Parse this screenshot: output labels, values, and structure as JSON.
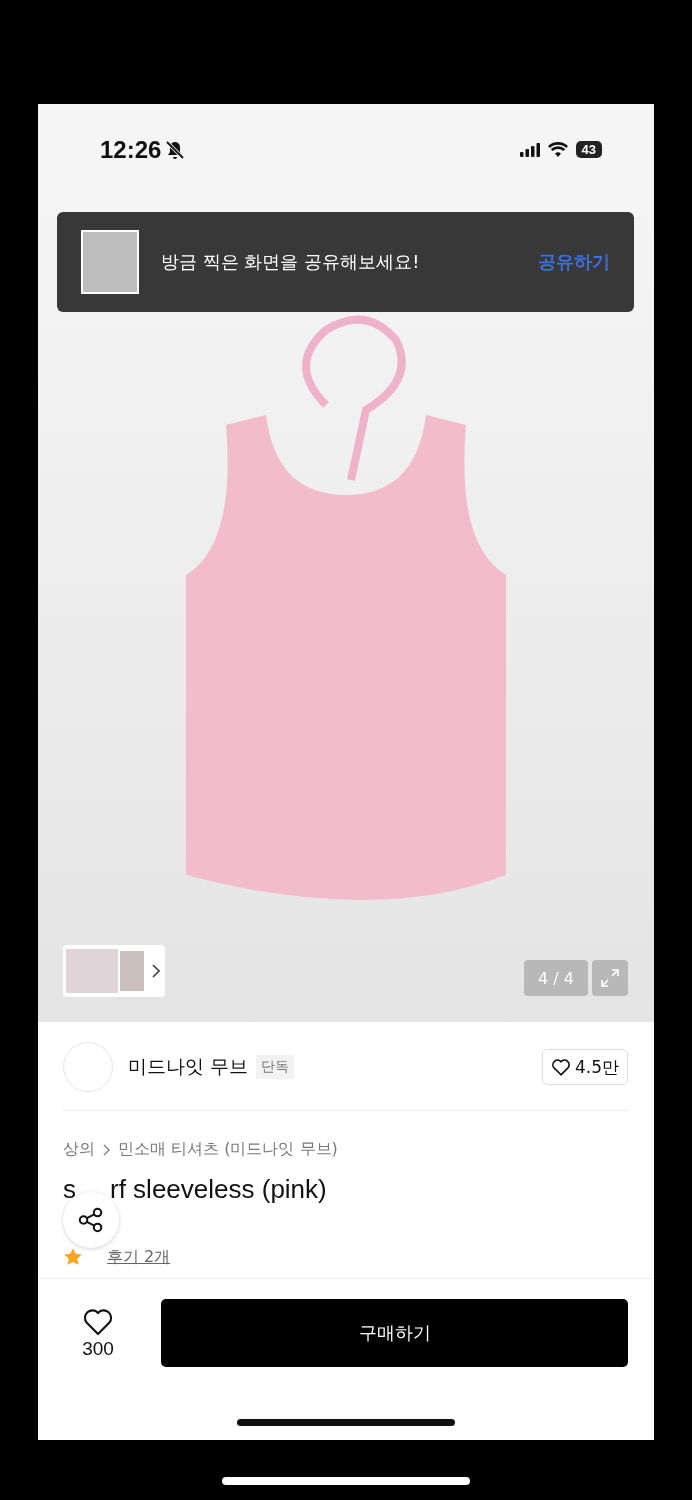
{
  "status_bar": {
    "time": "12:26",
    "silent": true,
    "battery": "43"
  },
  "share_banner": {
    "message": "방금 찍은 화면을 공유해보세요!",
    "action": "공유하기"
  },
  "gallery": {
    "counter": "4 / 4"
  },
  "store": {
    "name": "미드나잇 무브",
    "badge": "단독",
    "likes": "4.5만"
  },
  "breadcrumb": [
    "상의",
    "민소매 티셔츠 (미드나잇 무브)"
  ],
  "title_parts": [
    "s",
    "rf sleeveless (pink)"
  ],
  "reviews_link": "후기 2개",
  "bottom_bar": {
    "wish_count": "300",
    "buy": "구매하기"
  }
}
